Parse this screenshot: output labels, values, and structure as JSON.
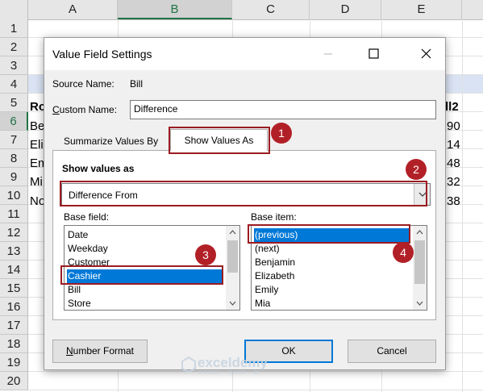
{
  "sheet": {
    "columns": [
      "A",
      "B",
      "C",
      "D",
      "E"
    ],
    "selected_column": "B",
    "rows": [
      "1",
      "2",
      "3",
      "4",
      "5",
      "6",
      "7",
      "8",
      "9",
      "10",
      "11",
      "12",
      "13",
      "14",
      "15",
      "16",
      "17",
      "18",
      "19",
      "20"
    ],
    "selected_row": "6",
    "left_cells": [
      "Ro",
      "Be",
      "Eli",
      "Em",
      "Mi",
      "No"
    ],
    "right_cells": [
      "ll2",
      "90",
      "14",
      "48",
      "32",
      "38"
    ]
  },
  "dialog": {
    "title": "Value Field Settings",
    "source_name_label": "Source Name:",
    "source_name_value": "Bill",
    "custom_name_label_underlined": "C",
    "custom_name_label_rest": "ustom Name:",
    "custom_name_value": "Difference",
    "tabs": [
      "Summarize Values By",
      "Show Values As"
    ],
    "show_values_as_label": "Show values as",
    "show_values_as_value": "Difference From",
    "base_field_label": "Base field:",
    "base_field_items": [
      "Date",
      "Weekday",
      "Customer",
      "Cashier",
      "Bill",
      "Store"
    ],
    "base_field_selected": "Cashier",
    "base_item_label": "Base item:",
    "base_item_items": [
      "(previous)",
      "(next)",
      "Benjamin",
      "Elizabeth",
      "Emily",
      "Mia"
    ],
    "base_item_selected": "(previous)",
    "number_format_underlined": "N",
    "number_format_rest": "umber Format",
    "ok_label": "OK",
    "cancel_label": "Cancel"
  },
  "annotations": [
    "1",
    "2",
    "3",
    "4"
  ],
  "watermark": {
    "name": "exceldemy",
    "tagline": "EXCEL · DATA · BI"
  },
  "colors": {
    "annotation": "#b22027",
    "selection": "#0078d7",
    "band": "#dae3f3"
  }
}
